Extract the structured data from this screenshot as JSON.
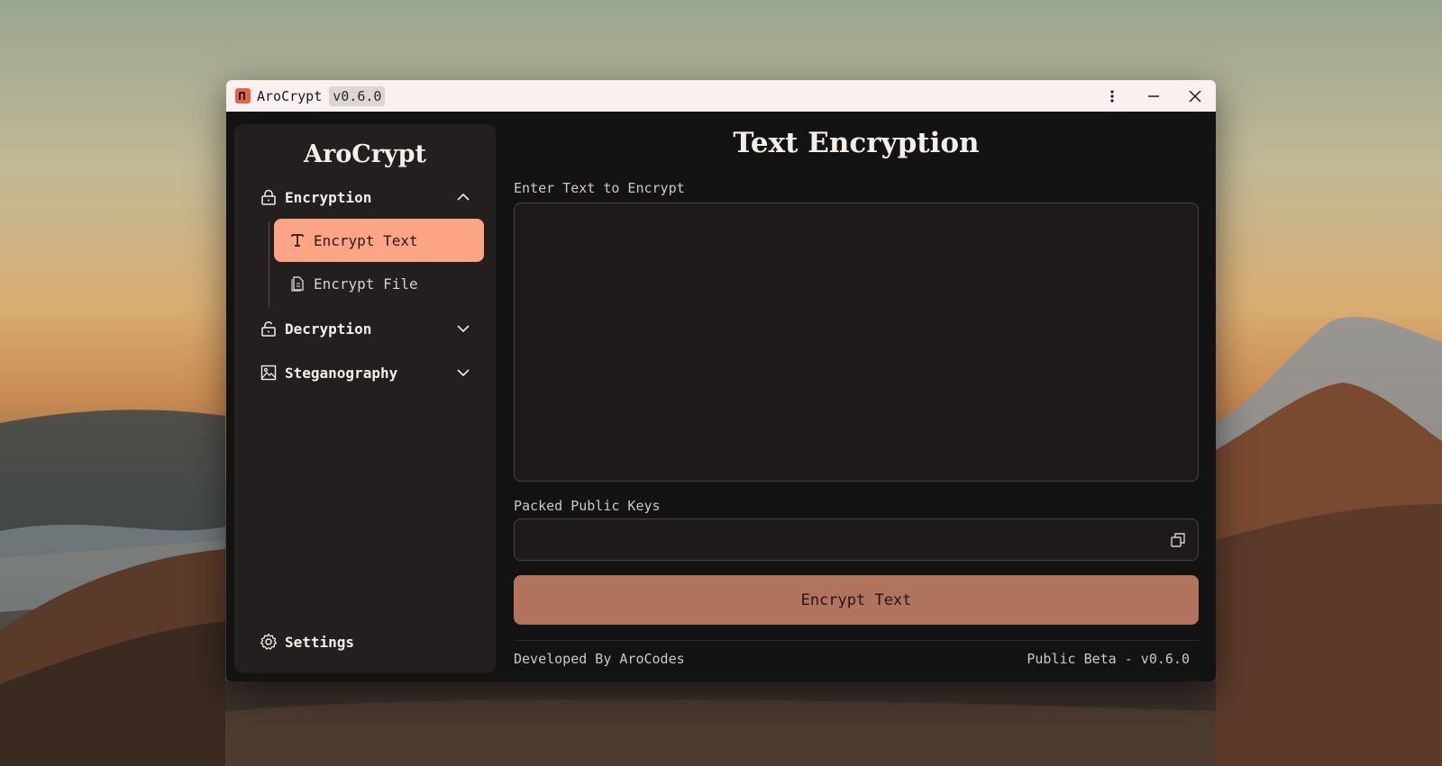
{
  "window": {
    "title": "AroCrypt",
    "version_chip": "v0.6.0",
    "controls": {
      "menu_icon": "kebab-menu-icon",
      "minimize_icon": "minimize-icon",
      "close_icon": "close-icon"
    }
  },
  "sidebar": {
    "brand": "AroCrypt",
    "sections": [
      {
        "label": "Encryption",
        "icon": "lock-icon",
        "expanded": true
      },
      {
        "label": "Decryption",
        "icon": "unlock-icon",
        "expanded": false
      },
      {
        "label": "Steganography",
        "icon": "image-icon",
        "expanded": false
      }
    ],
    "encryption_items": [
      {
        "label": "Encrypt Text",
        "icon": "text-icon",
        "active": true
      },
      {
        "label": "Encrypt File",
        "icon": "file-icon",
        "active": false
      }
    ],
    "settings_label": "Settings"
  },
  "main": {
    "title": "Text Encryption",
    "text_label": "Enter Text to Encrypt",
    "text_value": "",
    "keys_label": "Packed Public Keys",
    "keys_value": "",
    "encrypt_button": "Encrypt Text",
    "footer_left": "Developed By AroCodes",
    "footer_right": "Public Beta - v0.6.0"
  },
  "colors": {
    "accent": "#fca484",
    "button": "#b1735e",
    "window_bg": "#141313",
    "sidebar_bg": "#231f1e",
    "titlebar_bg": "#f8f1ef"
  }
}
